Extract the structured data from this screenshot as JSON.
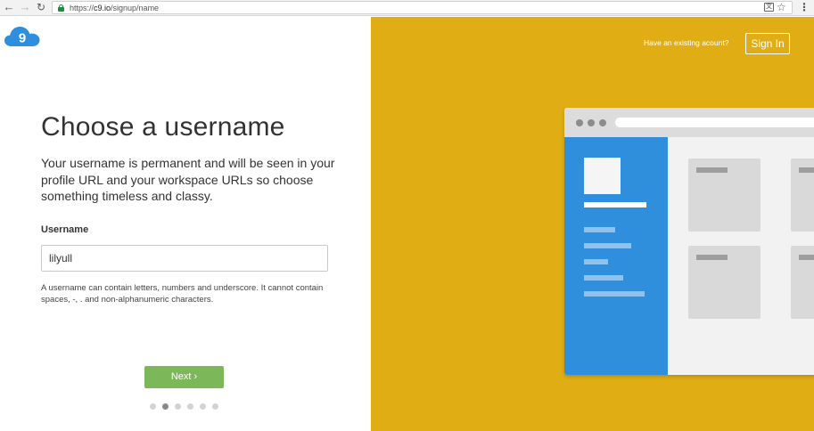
{
  "browser": {
    "url_scheme": "https://",
    "url_host": "c9.io",
    "url_path": "/signup/name",
    "icons": [
      "back-icon",
      "forward-icon",
      "reload-icon",
      "lock-icon",
      "translate-icon",
      "star-icon",
      "menu-icon"
    ]
  },
  "logo": {
    "text": "9"
  },
  "form": {
    "heading": "Choose a username",
    "intro": "Your username is permanent and will be seen in your profile URL and your workspace URLs so choose something timeless and classy.",
    "field_label": "Username",
    "field_value": "lilyull",
    "help_text": "A username can contain letters, numbers and underscore. It cannot contain spaces, -, . and non-alphanumeric characters.",
    "next_label": "Next",
    "steps_total": 6,
    "steps_active": 2
  },
  "right": {
    "account_text": "Have an existing acount?",
    "signin_label": "Sign In"
  },
  "colors": {
    "accent_yellow": "#e0ae14",
    "next_green": "#7cb85a",
    "illustration_blue": "#2f8fdd",
    "logo_blue": "#2f8fdd"
  }
}
